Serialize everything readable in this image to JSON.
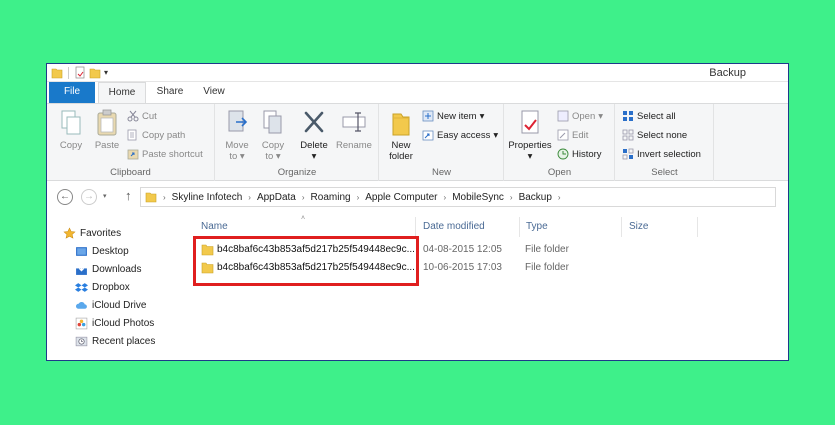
{
  "window": {
    "title": "Backup"
  },
  "ribbon_tabs": [
    "File",
    "Home",
    "Share",
    "View"
  ],
  "ribbon": {
    "clipboard": {
      "label": "Clipboard",
      "copy": "Copy",
      "paste": "Paste",
      "cut": "Cut",
      "copy_path": "Copy path",
      "paste_shortcut": "Paste shortcut"
    },
    "organize": {
      "label": "Organize",
      "move_to_line1": "Move",
      "move_to_line2": "to",
      "copy_to_line1": "Copy",
      "copy_to_line2": "to",
      "delete": "Delete",
      "rename": "Rename"
    },
    "new": {
      "label": "New",
      "new_folder_line1": "New",
      "new_folder_line2": "folder",
      "new_item": "New item",
      "easy_access": "Easy access"
    },
    "open": {
      "label": "Open",
      "properties": "Properties",
      "open": "Open",
      "edit": "Edit",
      "history": "History"
    },
    "select": {
      "label": "Select",
      "select_all": "Select all",
      "select_none": "Select none",
      "invert_selection": "Invert selection"
    }
  },
  "breadcrumb": [
    "Skyline Infotech",
    "AppData",
    "Roaming",
    "Apple Computer",
    "MobileSync",
    "Backup"
  ],
  "nav_pane": {
    "favorites": "Favorites",
    "items": [
      "Desktop",
      "Downloads",
      "Dropbox",
      "iCloud Drive",
      "iCloud Photos",
      "Recent places"
    ]
  },
  "columns": {
    "name": "Name",
    "date_modified": "Date modified",
    "type": "Type",
    "size": "Size"
  },
  "files": [
    {
      "name": "b4c8baf6c43b853af5d217b25f549448ec9c...",
      "date": "04-08-2015 12:05",
      "type": "File folder"
    },
    {
      "name": "b4c8baf6c43b853af5d217b25f549448ec9c...",
      "date": "10-06-2015 17:03",
      "type": "File folder"
    }
  ],
  "colors": {
    "background": "#3ef08a",
    "file_tab": "#1979ca",
    "highlight_box": "#e01f1f",
    "folder": "#f2c94c"
  }
}
